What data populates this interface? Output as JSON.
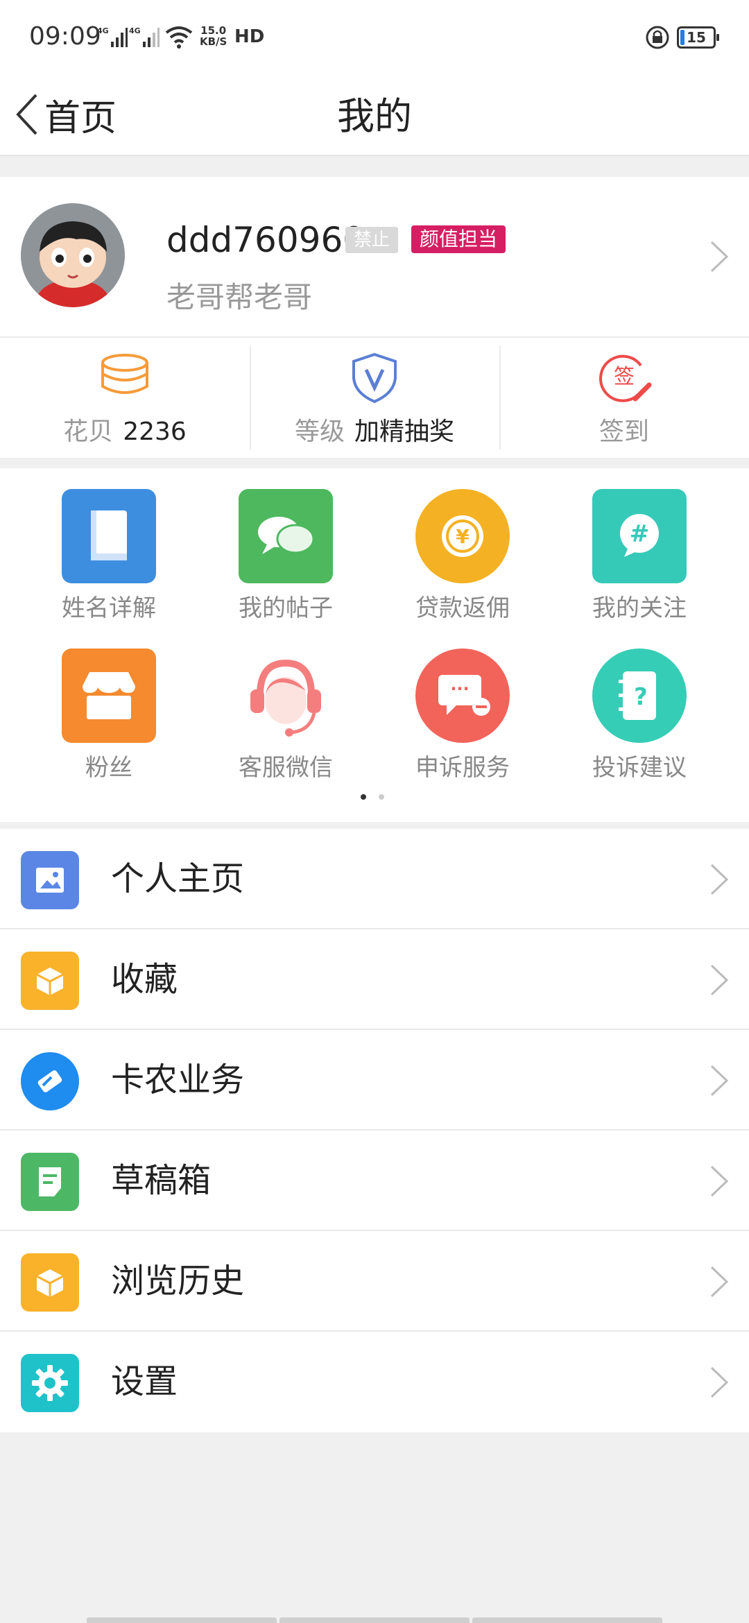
{
  "status_bar": {
    "time": "09:09",
    "net_speed_top": "15.0",
    "net_speed_bottom": "KB/S",
    "hd_label": "HD",
    "battery": "15"
  },
  "nav": {
    "back_label": "首页",
    "title": "我的"
  },
  "profile": {
    "username": "ddd760960",
    "badge_ban": "禁止",
    "badge_role": "颜值担当",
    "bio": "老哥帮老哥"
  },
  "stats": [
    {
      "label": "花贝",
      "value": "2236",
      "icon": "coins-icon"
    },
    {
      "label": "等级",
      "value": "加精抽奖",
      "icon": "shield-v-icon"
    },
    {
      "label": "签到",
      "value": "",
      "icon": "sign-in-icon",
      "icon_text": "签"
    }
  ],
  "grid": [
    {
      "label": "姓名详解",
      "icon": "book-icon",
      "color": "#3e8ee0"
    },
    {
      "label": "我的帖子",
      "icon": "chat-bubbles-icon",
      "color": "#4db85e"
    },
    {
      "label": "贷款返佣",
      "icon": "coin-icon",
      "color": "#f4b123",
      "icon_text": "¥"
    },
    {
      "label": "我的关注",
      "icon": "hashtag-icon",
      "color": "#35c9b8",
      "icon_text": "#"
    },
    {
      "label": "粉丝",
      "icon": "shop-icon",
      "color": "#f58a2e"
    },
    {
      "label": "客服微信",
      "icon": "customer-service-icon",
      "color": "#f47e7e"
    },
    {
      "label": "申诉服务",
      "icon": "complaint-message-icon",
      "color": "#f2635a",
      "icon_text": "···"
    },
    {
      "label": "投诉建议",
      "icon": "question-notebook-icon",
      "color": "#35cdb5",
      "icon_text": "?"
    }
  ],
  "menu": [
    {
      "label": "个人主页",
      "icon": "image-icon",
      "color": "#5b86e5"
    },
    {
      "label": "收藏",
      "icon": "box-icon",
      "color": "#f9b22a"
    },
    {
      "label": "卡农业务",
      "icon": "handshake-icon",
      "color": "#1f8cf0"
    },
    {
      "label": "草稿箱",
      "icon": "draft-icon",
      "color": "#4cb866"
    },
    {
      "label": "浏览历史",
      "icon": "box-icon",
      "color": "#f9b22a"
    },
    {
      "label": "设置",
      "icon": "gear-icon",
      "color": "#1fc2c9"
    }
  ]
}
